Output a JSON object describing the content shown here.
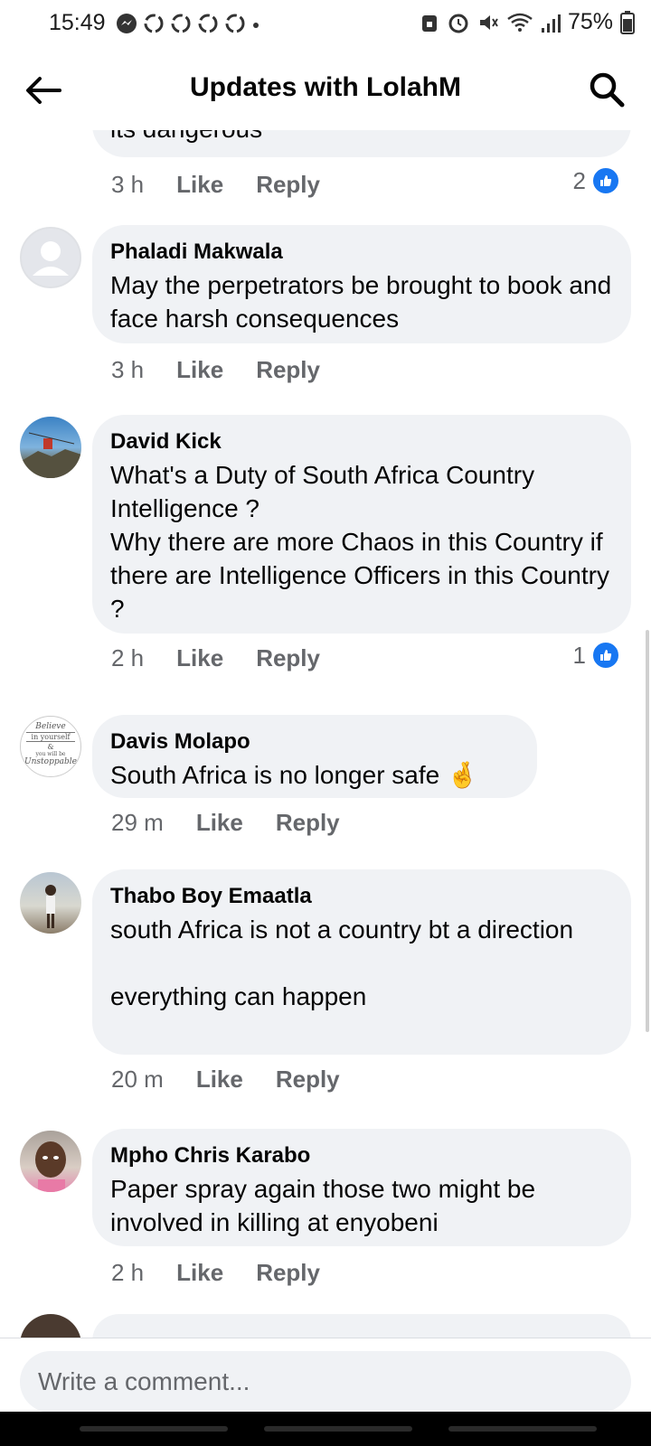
{
  "status_bar": {
    "time": "15:49",
    "battery_percent": "75%",
    "notification_icons": [
      "messenger-icon",
      "recycle-icon",
      "recycle-icon",
      "recycle-icon",
      "recycle-icon",
      "dot-icon"
    ],
    "right_icons": [
      "lock-icon",
      "alarm-icon",
      "mute-icon",
      "wifi-icon",
      "signal-icon",
      "battery-icon"
    ]
  },
  "header": {
    "title": "Updates with LolahM"
  },
  "partial_top_comment": {
    "text_fragment": "its dangerous",
    "time": "3 h",
    "like_label": "Like",
    "reply_label": "Reply",
    "reaction_count": "2"
  },
  "comments": [
    {
      "name": "Phaladi Makwala",
      "text": "May the perpetrators be brought to book and face harsh consequences",
      "time": "3 h",
      "like_label": "Like",
      "reply_label": "Reply"
    },
    {
      "name": "David Kick",
      "text": "What's a Duty of South Africa Country Intelligence ?\nWhy there are more Chaos in this Country if there are Intelligence Officers in this Country ?",
      "time": "2 h",
      "like_label": "Like",
      "reply_label": "Reply",
      "reaction_count": "1"
    },
    {
      "name": "Davis Molapo",
      "text": "South Africa is no longer safe",
      "emoji": "🤞",
      "time": "29 m",
      "like_label": "Like",
      "reply_label": "Reply",
      "avatar_text": [
        "Believe",
        "in yourself",
        "&",
        "you will be",
        "Unstoppable"
      ]
    },
    {
      "name": "Thabo Boy Emaatla",
      "text": "south Africa is not a country bt a direction\n\neverything can happen",
      "time": "20 m",
      "like_label": "Like",
      "reply_label": "Reply"
    },
    {
      "name": "Mpho Chris Karabo",
      "text": "Paper spray again those two might be involved in  killing  at enyobeni",
      "time": "2 h",
      "like_label": "Like",
      "reply_label": "Reply"
    }
  ],
  "composer": {
    "placeholder": "Write a comment..."
  },
  "colors": {
    "bubble": "#f0f2f5",
    "like_blue": "#1877f2",
    "secondary_text": "#65676b"
  }
}
